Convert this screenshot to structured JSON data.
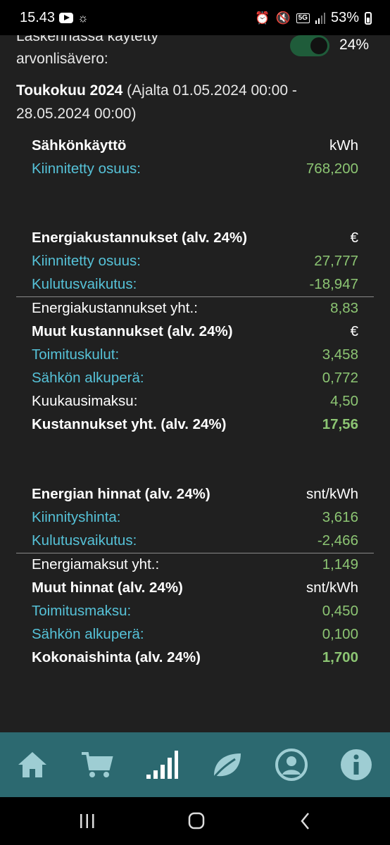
{
  "status_bar": {
    "time": "15.43",
    "battery": "53%",
    "network": "5G"
  },
  "settings": {
    "vat_label": "Laskennassa käytetty arvonlisävero:",
    "vat_value": "24%",
    "vat_enabled": true
  },
  "period": {
    "title": "Toukokuu 2024",
    "range": "(Ajalta 01.05.2024 00:00 - 28.05.2024 00:00)"
  },
  "consumption": {
    "header": "Sähkönkäyttö",
    "unit": "kWh",
    "rows": [
      {
        "label": "Kiinnitetty osuus:",
        "value": "768,200"
      }
    ]
  },
  "energy_costs": {
    "header": "Energiakustannukset (alv. 24%)",
    "unit": "€",
    "rows": [
      {
        "label": "Kiinnitetty osuus:",
        "value": "27,777"
      },
      {
        "label": "Kulutusvaikutus:",
        "value": "-18,947"
      }
    ],
    "total_label": "Energiakustannukset yht.:",
    "total_value": "8,83"
  },
  "other_costs": {
    "header": "Muut kustannukset (alv. 24%)",
    "unit": "€",
    "rows": [
      {
        "label": "Toimituskulut:",
        "value": "3,458"
      },
      {
        "label": "Sähkön alkuperä:",
        "value": "0,772"
      },
      {
        "label": "Kuukausimaksu:",
        "value": "4,50"
      }
    ],
    "grand_total_label": "Kustannukset yht. (alv. 24%)",
    "grand_total_value": "17,56"
  },
  "energy_prices": {
    "header": "Energian hinnat (alv. 24%)",
    "unit": "snt/kWh",
    "rows": [
      {
        "label": "Kiinnityshinta:",
        "value": "3,616"
      },
      {
        "label": "Kulutusvaikutus:",
        "value": "-2,466"
      }
    ],
    "total_label": "Energiamaksut yht.:",
    "total_value": "1,149"
  },
  "other_prices": {
    "header": "Muut hinnat (alv. 24%)",
    "unit": "snt/kWh",
    "rows": [
      {
        "label": "Toimitusmaksu:",
        "value": "0,450"
      },
      {
        "label": "Sähkön alkuperä:",
        "value": "0,100"
      }
    ],
    "grand_total_label": "Kokonaishinta (alv. 24%)",
    "grand_total_value": "1,700"
  },
  "nav": {
    "items": [
      {
        "icon": "home-icon"
      },
      {
        "icon": "cart-icon"
      },
      {
        "icon": "signal-bars-icon"
      },
      {
        "icon": "leaf-icon"
      },
      {
        "icon": "user-icon"
      },
      {
        "icon": "info-icon"
      }
    ],
    "icon_color": "#9ecdd3",
    "active_icon_color": "#ffffff"
  },
  "colors": {
    "background": "#202020",
    "label_accent": "#56c2d8",
    "value_accent": "#8cc573",
    "nav_background": "#2c6970"
  }
}
